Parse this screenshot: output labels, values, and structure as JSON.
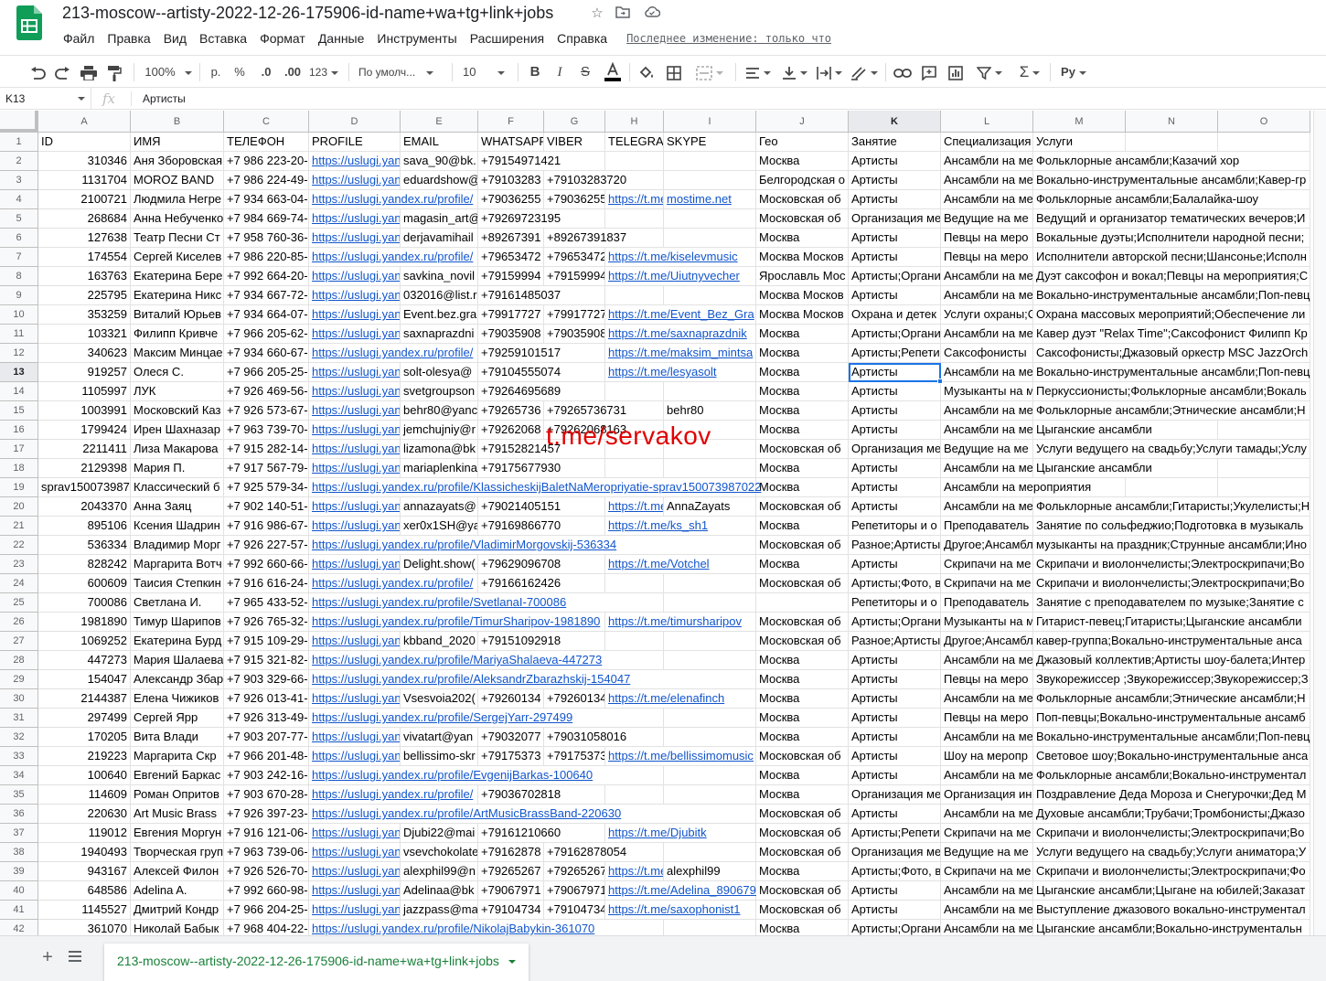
{
  "doc": {
    "title": "213-moscow--artisty-2022-12-26-175906-id-name+wa+tg+link+jobs",
    "last_edit": "Последнее изменение: только что"
  },
  "menu": [
    "Файл",
    "Правка",
    "Вид",
    "Вставка",
    "Формат",
    "Данные",
    "Инструменты",
    "Расширения",
    "Справка"
  ],
  "toolbar": {
    "zoom": "100%",
    "currency": "р.",
    "percent": "%",
    "dec_less": ".0",
    "dec_more": ".00",
    "format_more": "123",
    "font": "По умолч...",
    "font_size": "10"
  },
  "formula": {
    "cell_ref": "K13",
    "fx": "fx",
    "value": "Артисты"
  },
  "colors": {
    "link": "#1155cc",
    "selection": "#1a73e8",
    "sheets_green": "#188038",
    "watermark": "#e00000"
  },
  "columns": [
    "A",
    "B",
    "C",
    "D",
    "E",
    "F",
    "G",
    "H",
    "I",
    "J",
    "K",
    "L",
    "M",
    "N",
    "O"
  ],
  "selected": {
    "row": 13,
    "col": "K"
  },
  "watermark": "t.me/servakov",
  "rows": [
    [
      "ID",
      "ИМЯ",
      "ТЕЛЕФОН",
      "PROFILE",
      "EMAIL",
      "WHATSAPP",
      "VIBER",
      "TELEGRAM",
      "SKYPE",
      "Гео",
      "Занятие",
      "Специализация",
      "Услуги",
      "",
      ""
    ],
    [
      "310346",
      "Аня Зборовская",
      "+7 986 223-20-",
      "https://uslugi.yan",
      "sava_90@bk.",
      "+79154971421",
      "",
      "",
      "",
      " Москва",
      "Артисты",
      "Ансамбли на ме",
      "Фольклорные ансамбли;Казачий хор",
      "",
      ""
    ],
    [
      "1131704",
      "MOROZ BAND",
      "+7 986 224-49-",
      "https://uslugi.yan",
      "eduardshow@",
      "+79103283",
      "+79103283720",
      "",
      "",
      " Белгородская о",
      "Артисты",
      "Ансамбли на ме",
      "Вокально-инструментальные ансамбли;Кавер-гр",
      "",
      ""
    ],
    [
      "2100721",
      "Людмила Негре",
      "+7 934 663-04-",
      "https://uslugi.yandex.ru/profile/",
      "",
      "+79036255",
      "+79036255",
      "https://t.me",
      "mostime.net",
      " Московская об",
      "Артисты",
      "Ансамбли на ме",
      "Фольклорные ансамбли;Балалайка-шоу",
      "",
      ""
    ],
    [
      "268684",
      "Анна Небученко",
      "+7 984 669-74-",
      "https://uslugi.yan",
      "magasin_art@",
      "+79269723195",
      "",
      "",
      "",
      " Московская об",
      "Организация ме",
      "Ведущие на ме",
      "Ведущий и организатор тематических вечеров;И",
      "",
      ""
    ],
    [
      "127638",
      "Театр Песни Ст",
      "+7 958 760-36-",
      "https://uslugi.yan",
      "derjavamihail",
      "+89267391",
      "+89267391837",
      "",
      "",
      " Москва",
      "Артисты",
      "Певцы на меро",
      "Вокальные дуэты;Исполнители народной песни;",
      "",
      ""
    ],
    [
      "174554",
      "Сергей Киселев",
      "+7 986 220-85-",
      "https://uslugi.yandex.ru/profile/",
      "",
      "+79653472",
      "+79653472",
      "https://t.me/kiselevmusic",
      "",
      " Москва Москов",
      "Артисты",
      "Певцы на меро",
      "Исполнители авторской песни;Шансонье;Исполн",
      "",
      ""
    ],
    [
      "163763",
      "Екатерина Бере",
      "+7 992 664-20-",
      "https://uslugi.yan",
      "savkina_novil",
      "+79159994",
      "+79159994",
      "https://t.me/Uiutnyvecher",
      "",
      " Ярославль Мос",
      "Артисты;Органи",
      "Ансамбли на ме",
      "Дуэт саксофон и вокал;Певцы на мероприятия;С",
      "",
      ""
    ],
    [
      "225795",
      "Екатерина Никс",
      "+7 934 667-72-",
      "https://uslugi.yan",
      "032016@list.r",
      "+79161485037",
      "",
      "",
      "",
      " Москва Москов",
      "Артисты",
      "Ансамбли на ме",
      "Вокально-инструментальные ансамбли;Поп-певц",
      "",
      ""
    ],
    [
      "353259",
      "Виталий Юрьев",
      "+7 934 664-07-",
      "https://uslugi.yan",
      "Event.bez.gra",
      "+79917727",
      "+79917727",
      "https://t.me/Event_Bez_Gra",
      "",
      " Москва Москов",
      "Охрана и детек",
      "Услуги охраны;С",
      "Охрана массовых мероприятий;Обеспечение ли",
      "",
      ""
    ],
    [
      "103321",
      "Филипп Кривче",
      "+7 966 205-62-",
      "https://uslugi.yan",
      "saxnaprazdni",
      "+79035908",
      "+79035908",
      "https://t.me/saxnaprazdnik",
      "",
      " Москва",
      "Артисты;Органи",
      "Ансамбли на ме",
      "Кавер дуэт \"Relax Time\";Саксофонист Филипп Кр",
      "",
      ""
    ],
    [
      "340623",
      "Максим Минцае",
      "+7 934 660-67-",
      "https://uslugi.yandex.ru/profile/",
      "",
      "+79259101517",
      "",
      "https://t.me/maksim_mintsa",
      "",
      " Москва",
      "Артисты;Репети",
      "Саксофонисты",
      "Саксофонисты;Джазовый оркестр MSC JazzOrch",
      "",
      ""
    ],
    [
      "919257",
      "Олеся С.",
      "+7 966 205-25-",
      "https://uslugi.yan",
      "solt-olesya@",
      "+79104555074",
      "",
      "https://t.me/lesyasolt",
      "",
      " Москва",
      "Артисты",
      "Ансамбли на ме",
      "Вокально-инструментальные ансамбли;Поп-певц",
      "",
      ""
    ],
    [
      "1105997",
      "ЛУК",
      "+7 926 469-56-",
      "https://uslugi.yan",
      "svetgroupson",
      "+79264695689",
      "",
      "",
      "",
      " Москва",
      "Артисты",
      "Музыканты на м",
      "Перкуссионисты;Фольклорные ансамбли;Вокаль",
      "",
      ""
    ],
    [
      "1003991",
      "Московский Каз",
      "+7 926 573-67-",
      "https://uslugi.yan",
      "behr80@yanc",
      "+79265736",
      "+79265736731",
      "",
      "behr80",
      " Москва",
      "Артисты",
      "Ансамбли на ме",
      "Фольклорные ансамбли;Этнические ансамбли;Н",
      "",
      ""
    ],
    [
      "1799424",
      "Ирен Шахназар",
      "+7 963 739-70-",
      "https://uslugi.yan",
      "jemchujniy@r",
      "+79262068",
      "+79262068163",
      "",
      "",
      " Москва",
      "Артисты",
      "Ансамбли на ме",
      "Цыганские ансамбли",
      "",
      ""
    ],
    [
      "2211411",
      "Лиза Макарова",
      "+7 915 282-14-",
      "https://uslugi.yan",
      "lizamona@bk",
      "+79152821457",
      "",
      "",
      "",
      " Московская об",
      "Организация ме",
      "Ведущие на ме",
      "Услуги ведущего на свадьбу;Услуги тамады;Услу",
      "",
      ""
    ],
    [
      "2129398",
      "Мария П.",
      "+7 917 567-79-",
      "https://uslugi.yan",
      "mariaplenkina",
      "+79175677930",
      "",
      "",
      "",
      " Москва",
      "Артисты",
      "Ансамбли на ме",
      "Цыганские ансамбли",
      "",
      ""
    ],
    [
      "sprav150073987",
      "Классический б",
      "+7 925 579-34-",
      "https://uslugi.yandex.ru/profile/KlassicheskijBaletNaMeropriyatie-sprav150073987022",
      "",
      "",
      "",
      "",
      "",
      " Москва",
      "Артисты",
      "Ансамбли на мероприятия",
      "",
      "",
      ""
    ],
    [
      "2043370",
      "Анна Заяц",
      "+7 902 140-51-",
      "https://uslugi.yan",
      "annazayats@",
      "+79021405151",
      "",
      "https://t.me",
      "AnnaZayats",
      " Московская об",
      "Артисты",
      "Ансамбли на ме",
      "Фольклорные ансамбли;Гитаристы;Укулелисты;Н",
      "",
      ""
    ],
    [
      "895106",
      "Ксения Шадрин",
      "+7 916 986-67-",
      "https://uslugi.yan",
      "xer0x1SH@ya",
      "+79169866770",
      "",
      "https://t.me/ks_sh1",
      "",
      " Москва",
      "Репетиторы и о",
      "Преподаватель",
      "Занятие по сольфеджио;Подготовка в музыкаль",
      "",
      ""
    ],
    [
      "536334",
      "Владимир Морг",
      "+7 926 227-57-",
      "https://uslugi.yandex.ru/profile/VladimirMorgovskij-536334",
      "",
      "",
      "",
      "",
      "",
      " Московская об",
      "Разное;Артисты",
      "Другое;Ансамбл",
      "музыканты на праздник;Струнные ансамбли;Ино",
      "",
      ""
    ],
    [
      "828242",
      "Маргарита Вотч",
      "+7 992 660-66-",
      "https://uslugi.yan",
      "Delight.show(",
      "+79629096708",
      "",
      "https://t.me/Votchel",
      "",
      " Москва",
      "Артисты",
      "Скрипачи на ме",
      "Скрипачи и виолончелисты;Электроскрипачи;Во",
      "",
      ""
    ],
    [
      "600609",
      "Таисия Степкин",
      "+7 916 616-24-",
      "https://uslugi.yandex.ru/profile/",
      "",
      "+79166162426",
      "",
      "",
      "",
      " Московская об",
      "Артисты;Фото, в",
      "Скрипачи на ме",
      "Скрипачи и виолончелисты;Электроскрипачи;Во",
      "",
      ""
    ],
    [
      "700086",
      "Светлана И.",
      "+7 965 433-52-",
      "https://uslugi.yandex.ru/profile/SvetlanaI-700086",
      "",
      "",
      "",
      "",
      "",
      "",
      "Репетиторы и о",
      "Преподаватель",
      "Занятие с преподавателем по музыке;Занятие с",
      "",
      ""
    ],
    [
      "1981890",
      "Тимур Шарипов",
      "+7 926 765-32-",
      "https://uslugi.yandex.ru/profile/TimurSharipov-1981890",
      "",
      "",
      "",
      "https://t.me/timursharipov",
      "",
      " Московская об",
      "Артисты;Органи",
      "Музыканты на м",
      "Гитарист-певец;Гитаристы;Цыганские ансамбли",
      "",
      ""
    ],
    [
      "1069252",
      "Екатерина Бурд",
      "+7 915 109-29-",
      "https://uslugi.yan",
      "kbband_2020",
      "+79151092918",
      "",
      "",
      "",
      " Московская об",
      "Разное;Артисты",
      "Другое;Ансамбл",
      "кавер-группа;Вокально-инструментальные анса",
      "",
      ""
    ],
    [
      "447273",
      "Мария Шалаева",
      "+7 915 321-82-",
      "https://uslugi.yandex.ru/profile/MariyaShalaeva-447273",
      "",
      "",
      "",
      "",
      "",
      " Москва",
      "Артисты",
      "Ансамбли на ме",
      "Джазовый коллектив;Артисты шоу-балета;Интер",
      "",
      ""
    ],
    [
      "154047",
      "Александр Збар",
      "+7 903 329-66-",
      "https://uslugi.yandex.ru/profile/AleksandrZbarazhskij-154047",
      "",
      "",
      "",
      "",
      "",
      " Москва",
      "Артисты",
      "Певцы на меро",
      "Звукорежиссер ;Звукорежиссер;Звукорежиссер;З",
      "",
      ""
    ],
    [
      "2144387",
      "Елена Чижиков",
      "+7 926 013-41-",
      "https://uslugi.yan",
      "Vsesvoia202(",
      "+79260134",
      "+79260134",
      "https://t.me/elenafinch",
      "",
      " Москва",
      "Артисты",
      "Ансамбли на ме",
      "Фольклорные ансамбли;Этнические ансамбли;Н",
      "",
      ""
    ],
    [
      "297499",
      "Сергей Ярр",
      "+7 926 313-49-",
      "https://uslugi.yandex.ru/profile/SergejYarr-297499",
      "",
      "",
      "",
      "",
      "",
      " Москва",
      "Артисты",
      "Певцы на меро",
      "Поп-певцы;Вокально-инструментальные ансамб",
      "",
      ""
    ],
    [
      "170205",
      "Вита Влади",
      "+7 903 207-77-",
      "https://uslugi.yan",
      "vivatart@yan",
      "+79032077",
      "+79031058016",
      "",
      "",
      " Москва",
      "Артисты",
      "Ансамбли на ме",
      "Вокально-инструментальные ансамбли;Поп-певц",
      "",
      ""
    ],
    [
      "219223",
      "Маргарита Скр",
      "+7 966 201-48-",
      "https://uslugi.yan",
      "bellissimo-skr",
      "+79175373",
      "+79175373",
      "https://t.me/bellissimomusic",
      "",
      " Московская об",
      "Артисты",
      "Шоу на меропр",
      "Световое шоу;Вокально-инструментальные анса",
      "",
      ""
    ],
    [
      "100640",
      "Евгений Баркас",
      "+7 903 242-16-",
      "https://uslugi.yandex.ru/profile/EvgenijBarkas-100640",
      "",
      "",
      "",
      "",
      "",
      " Москва",
      "Артисты",
      "Ансамбли на ме",
      "Фольклорные ансамбли;Вокально-инструментал",
      "",
      ""
    ],
    [
      "114609",
      "Роман Опритов",
      "+7 903 670-28-",
      "https://uslugi.yandex.ru/profile/",
      "",
      "+79036702818",
      "",
      "",
      "",
      " Москва",
      "Организация ме",
      "Организация ин",
      "Поздравление Деда Мороза и Снегурочки;Дед М",
      "",
      ""
    ],
    [
      "220630",
      "Art Music Brass",
      "+7 926 397-23-",
      "https://uslugi.yandex.ru/profile/ArtMusicBrassBand-220630",
      "",
      "",
      "",
      "",
      "",
      " Московская об",
      "Артисты",
      "Ансамбли на ме",
      "Духовые ансамбли;Трубачи;Тромбонисты;Джазо",
      "",
      ""
    ],
    [
      "119012",
      "Евгения Моргун",
      "+7 916 121-06-",
      "https://uslugi.yan",
      "Djubi22@mai",
      "+79161210660",
      "",
      "https://t.me/Djubitk",
      "",
      " Московская об",
      "Артисты;Репети",
      "Скрипачи на ме",
      "Скрипачи и виолончелисты;Электроскрипачи;Во",
      "",
      ""
    ],
    [
      "1940493",
      "Творческая груп",
      "+7 963 739-06-",
      "https://uslugi.yan",
      "vsevchokolate",
      "+79162878",
      "+79162878054",
      "",
      "",
      " Московская об",
      "Организация ме",
      "Ведущие на ме",
      "Услуги ведущего на свадьбу;Услуги аниматора;У",
      "",
      ""
    ],
    [
      "943167",
      "Алексей Филон",
      "+7 926 526-70-",
      "https://uslugi.yan",
      "alexphil99@n",
      "+79265267",
      "+79265267",
      "https://t.me",
      "alexphil99",
      " Москва",
      "Артисты;Фото, в",
      "Скрипачи на ме",
      "Скрипачи и виолончелисты;Электроскрипачи;Фо",
      "",
      ""
    ],
    [
      "648586",
      "Adelina A.",
      "+7 992 660-98-",
      "https://uslugi.yan",
      "Adelinaa@bk",
      "+79067971",
      "+79067971",
      "https://t.me/Adelina_890679",
      "",
      " Московская об",
      "Артисты",
      "Ансамбли на ме",
      "Цыганские ансамбли;Цыгане на юбилей;Заказат",
      "",
      ""
    ],
    [
      "1145527",
      "Дмитрий Кондр",
      "+7 966 204-25-",
      "https://uslugi.yan",
      "jazzpass@ma",
      "+79104734",
      "+79104734",
      "https://t.me/saxophonist1",
      "",
      " Московская об",
      "Артисты",
      "Ансамбли на ме",
      "Выступление джазового вокально-инструментал",
      "",
      ""
    ],
    [
      "361070",
      "Николай Бабык",
      "+7 968 404-22-",
      "https://uslugi.yandex.ru/profile/NikolajBabykin-361070",
      "",
      "",
      "",
      "",
      "",
      " Москва",
      "Артисты;Органи",
      "Ансамбли на ме",
      "Цыганские ансамбли;Вокально-инструментальн",
      "",
      ""
    ]
  ],
  "sheet_tab": "213-moscow--artisty-2022-12-26-175906-id-name+wa+tg+link+jobs"
}
